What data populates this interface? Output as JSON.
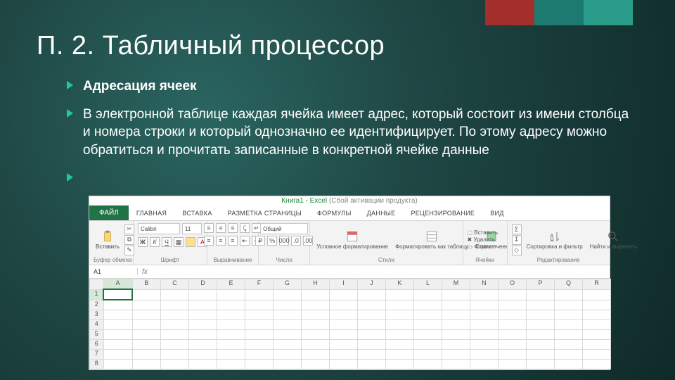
{
  "slide": {
    "title": "П. 2. Табличный процессор",
    "bullets": [
      {
        "text": "Адресация ячеек",
        "bold": true
      },
      {
        "text": "В электронной таблице каждая ячейка имеет адрес, который состоит из имени столбца и номера строки и который однозначно ее идентифицирует. По этому адресу можно обратиться и прочитать записанные в конкретной ячейке данные",
        "bold": false
      },
      {
        "text": "",
        "bold": false
      }
    ]
  },
  "excel": {
    "titlebar": {
      "file": "Книга1 - Excel",
      "status": "(Сбой активации продукта)"
    },
    "file_tab": "ФАЙЛ",
    "tabs": [
      "ГЛАВНАЯ",
      "ВСТАВКА",
      "РАЗМЕТКА СТРАНИЦЫ",
      "ФОРМУЛЫ",
      "ДАННЫЕ",
      "РЕЦЕНЗИРОВАНИЕ",
      "ВИД"
    ],
    "groups": {
      "clipboard": {
        "paste": "Вставить",
        "label": "Буфер обмена"
      },
      "font": {
        "name": "Calibri",
        "size": "11",
        "label": "Шрифт"
      },
      "align": {
        "label": "Выравнивание"
      },
      "number": {
        "format": "Общий",
        "label": "Число"
      },
      "styles": {
        "cond": "Условное форматирование",
        "fmt": "Форматировать как таблицу",
        "cell": "Стили ячеек",
        "label": "Стили"
      },
      "cells": {
        "insert": "Вставить",
        "delete": "Удалить",
        "format": "Формат",
        "label": "Ячейки"
      },
      "editing": {
        "sort": "Сортировка и фильтр",
        "find": "Найти и выделить",
        "label": "Редактирование"
      }
    },
    "namebox": "A1",
    "columns": [
      "A",
      "B",
      "C",
      "D",
      "E",
      "F",
      "G",
      "H",
      "I",
      "J",
      "K",
      "L",
      "M",
      "N",
      "O",
      "P",
      "Q",
      "R"
    ],
    "rows": [
      "1",
      "2",
      "3",
      "4",
      "5",
      "6",
      "7",
      "8"
    ]
  }
}
